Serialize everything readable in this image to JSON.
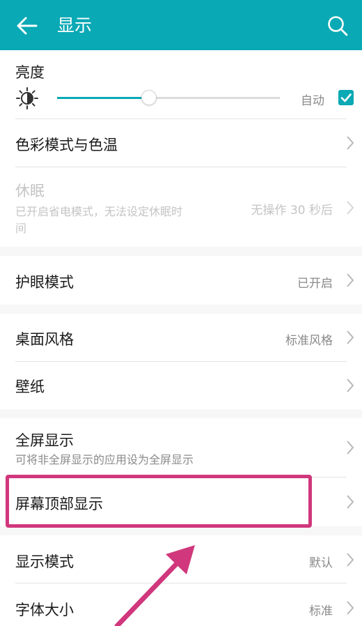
{
  "colors": {
    "accent": "#09a9b5",
    "highlight": "#d0377c"
  },
  "header": {
    "title": "显示",
    "back_icon": "arrow-left-icon",
    "search_icon": "search-icon"
  },
  "brightness": {
    "label": "亮度",
    "icon": "brightness-icon",
    "level": 0.41,
    "auto_label": "自动",
    "auto_checked": true
  },
  "rows": {
    "color_mode": {
      "label": "色彩模式与色温"
    },
    "sleep": {
      "label": "休眠",
      "sub_line1": "已开启省电模式，无法设定休眠时",
      "sub_line2": "间",
      "value": "无操作 30 秒后",
      "enabled": false
    },
    "eye_comfort": {
      "label": "护眼模式",
      "value": "已开启"
    },
    "home_style": {
      "label": "桌面风格",
      "value": "标准风格"
    },
    "wallpaper": {
      "label": "壁纸"
    },
    "full_screen": {
      "label": "全屏显示",
      "sub": "可将非全屏显示的应用设为全屏显示"
    },
    "notch": {
      "label": "屏幕顶部显示"
    },
    "display_mode": {
      "label": "显示模式",
      "value": "默认"
    },
    "font_size": {
      "label": "字体大小",
      "value": "标准"
    }
  }
}
